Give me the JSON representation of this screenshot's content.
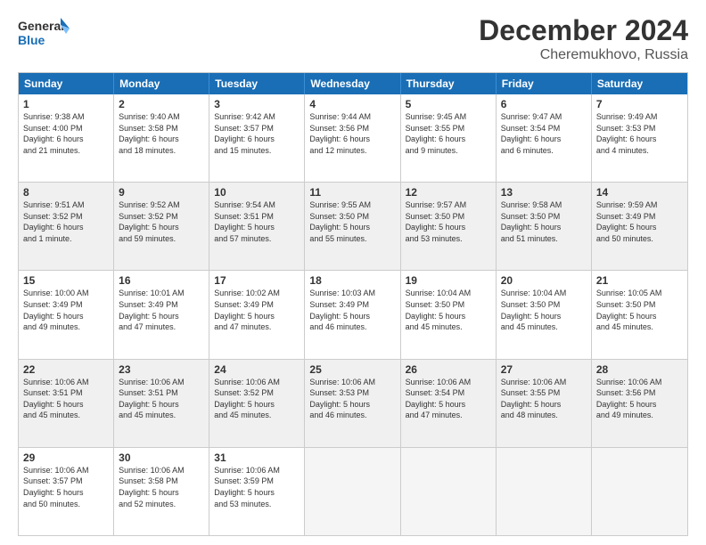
{
  "header": {
    "logo_general": "General",
    "logo_blue": "Blue",
    "month_title": "December 2024",
    "location": "Cheremukhovo, Russia"
  },
  "weekdays": [
    "Sunday",
    "Monday",
    "Tuesday",
    "Wednesday",
    "Thursday",
    "Friday",
    "Saturday"
  ],
  "rows": [
    [
      {
        "day": "1",
        "text": "Sunrise: 9:38 AM\nSunset: 4:00 PM\nDaylight: 6 hours\nand 21 minutes.",
        "shaded": false
      },
      {
        "day": "2",
        "text": "Sunrise: 9:40 AM\nSunset: 3:58 PM\nDaylight: 6 hours\nand 18 minutes.",
        "shaded": false
      },
      {
        "day": "3",
        "text": "Sunrise: 9:42 AM\nSunset: 3:57 PM\nDaylight: 6 hours\nand 15 minutes.",
        "shaded": false
      },
      {
        "day": "4",
        "text": "Sunrise: 9:44 AM\nSunset: 3:56 PM\nDaylight: 6 hours\nand 12 minutes.",
        "shaded": false
      },
      {
        "day": "5",
        "text": "Sunrise: 9:45 AM\nSunset: 3:55 PM\nDaylight: 6 hours\nand 9 minutes.",
        "shaded": false
      },
      {
        "day": "6",
        "text": "Sunrise: 9:47 AM\nSunset: 3:54 PM\nDaylight: 6 hours\nand 6 minutes.",
        "shaded": false
      },
      {
        "day": "7",
        "text": "Sunrise: 9:49 AM\nSunset: 3:53 PM\nDaylight: 6 hours\nand 4 minutes.",
        "shaded": false
      }
    ],
    [
      {
        "day": "8",
        "text": "Sunrise: 9:51 AM\nSunset: 3:52 PM\nDaylight: 6 hours\nand 1 minute.",
        "shaded": true
      },
      {
        "day": "9",
        "text": "Sunrise: 9:52 AM\nSunset: 3:52 PM\nDaylight: 5 hours\nand 59 minutes.",
        "shaded": true
      },
      {
        "day": "10",
        "text": "Sunrise: 9:54 AM\nSunset: 3:51 PM\nDaylight: 5 hours\nand 57 minutes.",
        "shaded": true
      },
      {
        "day": "11",
        "text": "Sunrise: 9:55 AM\nSunset: 3:50 PM\nDaylight: 5 hours\nand 55 minutes.",
        "shaded": true
      },
      {
        "day": "12",
        "text": "Sunrise: 9:57 AM\nSunset: 3:50 PM\nDaylight: 5 hours\nand 53 minutes.",
        "shaded": true
      },
      {
        "day": "13",
        "text": "Sunrise: 9:58 AM\nSunset: 3:50 PM\nDaylight: 5 hours\nand 51 minutes.",
        "shaded": true
      },
      {
        "day": "14",
        "text": "Sunrise: 9:59 AM\nSunset: 3:49 PM\nDaylight: 5 hours\nand 50 minutes.",
        "shaded": true
      }
    ],
    [
      {
        "day": "15",
        "text": "Sunrise: 10:00 AM\nSunset: 3:49 PM\nDaylight: 5 hours\nand 49 minutes.",
        "shaded": false
      },
      {
        "day": "16",
        "text": "Sunrise: 10:01 AM\nSunset: 3:49 PM\nDaylight: 5 hours\nand 47 minutes.",
        "shaded": false
      },
      {
        "day": "17",
        "text": "Sunrise: 10:02 AM\nSunset: 3:49 PM\nDaylight: 5 hours\nand 47 minutes.",
        "shaded": false
      },
      {
        "day": "18",
        "text": "Sunrise: 10:03 AM\nSunset: 3:49 PM\nDaylight: 5 hours\nand 46 minutes.",
        "shaded": false
      },
      {
        "day": "19",
        "text": "Sunrise: 10:04 AM\nSunset: 3:50 PM\nDaylight: 5 hours\nand 45 minutes.",
        "shaded": false
      },
      {
        "day": "20",
        "text": "Sunrise: 10:04 AM\nSunset: 3:50 PM\nDaylight: 5 hours\nand 45 minutes.",
        "shaded": false
      },
      {
        "day": "21",
        "text": "Sunrise: 10:05 AM\nSunset: 3:50 PM\nDaylight: 5 hours\nand 45 minutes.",
        "shaded": false
      }
    ],
    [
      {
        "day": "22",
        "text": "Sunrise: 10:06 AM\nSunset: 3:51 PM\nDaylight: 5 hours\nand 45 minutes.",
        "shaded": true
      },
      {
        "day": "23",
        "text": "Sunrise: 10:06 AM\nSunset: 3:51 PM\nDaylight: 5 hours\nand 45 minutes.",
        "shaded": true
      },
      {
        "day": "24",
        "text": "Sunrise: 10:06 AM\nSunset: 3:52 PM\nDaylight: 5 hours\nand 45 minutes.",
        "shaded": true
      },
      {
        "day": "25",
        "text": "Sunrise: 10:06 AM\nSunset: 3:53 PM\nDaylight: 5 hours\nand 46 minutes.",
        "shaded": true
      },
      {
        "day": "26",
        "text": "Sunrise: 10:06 AM\nSunset: 3:54 PM\nDaylight: 5 hours\nand 47 minutes.",
        "shaded": true
      },
      {
        "day": "27",
        "text": "Sunrise: 10:06 AM\nSunset: 3:55 PM\nDaylight: 5 hours\nand 48 minutes.",
        "shaded": true
      },
      {
        "day": "28",
        "text": "Sunrise: 10:06 AM\nSunset: 3:56 PM\nDaylight: 5 hours\nand 49 minutes.",
        "shaded": true
      }
    ],
    [
      {
        "day": "29",
        "text": "Sunrise: 10:06 AM\nSunset: 3:57 PM\nDaylight: 5 hours\nand 50 minutes.",
        "shaded": false
      },
      {
        "day": "30",
        "text": "Sunrise: 10:06 AM\nSunset: 3:58 PM\nDaylight: 5 hours\nand 52 minutes.",
        "shaded": false
      },
      {
        "day": "31",
        "text": "Sunrise: 10:06 AM\nSunset: 3:59 PM\nDaylight: 5 hours\nand 53 minutes.",
        "shaded": false
      },
      {
        "day": "",
        "text": "",
        "shaded": true,
        "empty": true
      },
      {
        "day": "",
        "text": "",
        "shaded": true,
        "empty": true
      },
      {
        "day": "",
        "text": "",
        "shaded": true,
        "empty": true
      },
      {
        "day": "",
        "text": "",
        "shaded": true,
        "empty": true
      }
    ]
  ]
}
